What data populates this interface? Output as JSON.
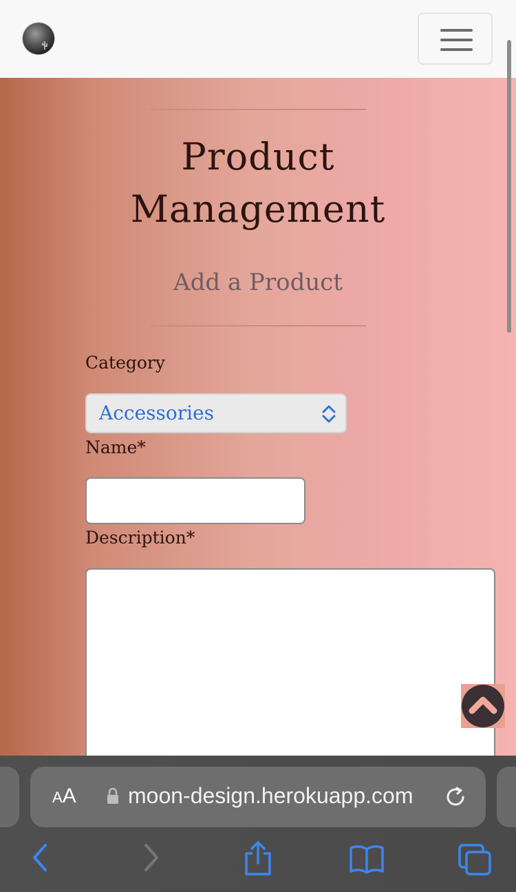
{
  "navbar": {
    "logo_alt": "logo",
    "menu_button": "menu-toggle"
  },
  "page": {
    "title_line1": "Product",
    "title_line2": "Management",
    "subtitle": "Add a Product"
  },
  "form": {
    "category_label": "Category",
    "category_value": "Accessories",
    "name_label": "Name*",
    "name_value": "",
    "description_label": "Description*",
    "description_value": ""
  },
  "browser": {
    "text_size_label_small": "A",
    "text_size_label_large": "A",
    "url": "moon-design.herokuapp.com"
  },
  "colors": {
    "accent": "#2d6fd6",
    "gradient_left": "#b5694a",
    "gradient_right": "#f5b4b1",
    "dark": "#2c1410"
  },
  "icons": [
    "hamburger-icon",
    "chevron-up-icon",
    "lock-icon",
    "reload-icon",
    "back-icon",
    "forward-icon",
    "share-icon",
    "bookmarks-icon",
    "tabs-icon",
    "select-arrows-icon"
  ]
}
